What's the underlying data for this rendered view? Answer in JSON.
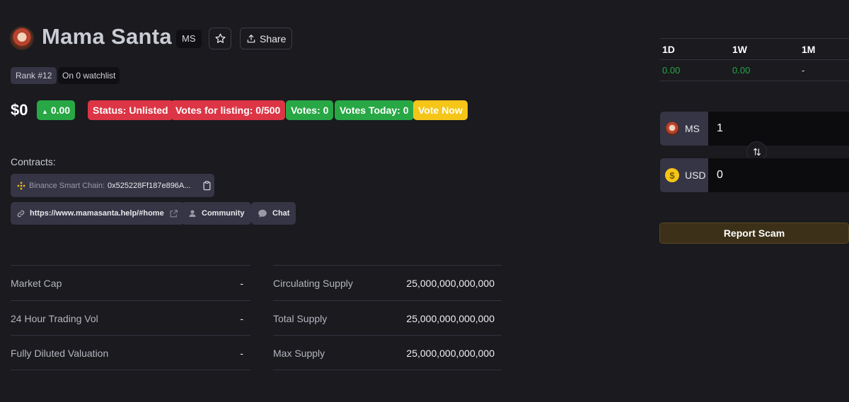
{
  "coin": {
    "name": "Mama Santa",
    "symbol": "MS",
    "share_label": "Share",
    "rank": "Rank #12",
    "watchlist": "On 0 watchlist"
  },
  "price": {
    "value": "$0",
    "change": "0.00",
    "status": "Status: Unlisted",
    "votes_listing": "Votes for listing: 0/500",
    "votes": "Votes: 0",
    "votes_today": "Votes Today: 0",
    "vote_now": "Vote Now"
  },
  "contracts": {
    "label": "Contracts:",
    "network": "Binance Smart Chain:",
    "address": "0x525228Ff187e896A...",
    "website": "https://www.mamasanta.help/#home",
    "community": "Community",
    "chat": "Chat"
  },
  "stats": {
    "left": [
      {
        "label": "Market Cap",
        "value": "-"
      },
      {
        "label": "24 Hour Trading Vol",
        "value": "-"
      },
      {
        "label": "Fully Diluted Valuation",
        "value": "-"
      }
    ],
    "right": [
      {
        "label": "Circulating Supply",
        "value": "25,000,000,000,000"
      },
      {
        "label": "Total Supply",
        "value": "25,000,000,000,000"
      },
      {
        "label": "Max Supply",
        "value": "25,000,000,000,000"
      }
    ]
  },
  "performance": {
    "headers": [
      "1D",
      "1W",
      "1M"
    ],
    "values": [
      "0.00",
      "0.00",
      "-"
    ],
    "colors": {
      "positive": "#28a745",
      "neutral": "#e8e8ec"
    }
  },
  "converter": {
    "from_symbol": "MS",
    "from_value": "1",
    "to_symbol": "USD",
    "to_value": "0"
  },
  "report_label": "Report Scam",
  "icons": [
    "star-icon",
    "share-icon",
    "binance-icon",
    "copy-icon",
    "link-icon",
    "external-link-icon",
    "user-icon",
    "chat-icon",
    "swap-icon",
    "usd-coin-icon"
  ]
}
